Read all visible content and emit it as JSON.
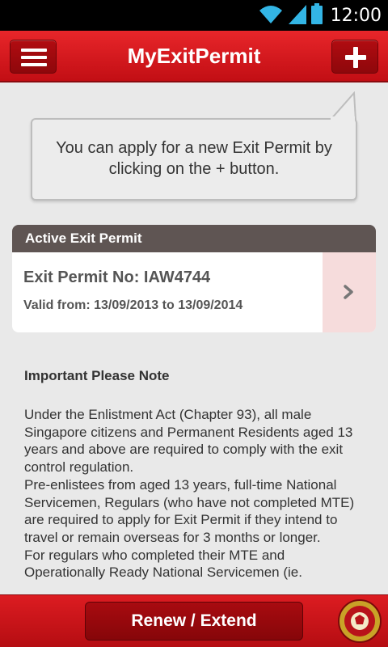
{
  "status_bar": {
    "time": "12:00",
    "icons": [
      "wifi-icon",
      "signal-icon",
      "battery-icon"
    ]
  },
  "header": {
    "title": "MyExitPermit",
    "menu_icon": "hamburger-menu-icon",
    "add_icon": "plus-icon"
  },
  "tip": {
    "text": "You can apply for a new Exit Permit by clicking on the + button."
  },
  "active_permit": {
    "section_title": "Active Exit Permit",
    "permit_no": "Exit Permit No: IAW4744",
    "valid": "Valid from: 13/09/2013 to 13/09/2014",
    "arrow_icon": "chevron-right-icon"
  },
  "note": {
    "title": "Important Please Note",
    "paragraphs": [
      "Under the Enlistment Act (Chapter 93), all male Singapore citizens and Permanent Residents aged 13 years and above are required to comply with the exit control regulation.",
      "Pre-enlistees from aged 13 years, full-time National Servicemen, Regulars (who have not completed MTE) are required to apply for Exit Permit if they intend to travel or remain overseas for 3 months or longer.",
      "For regulars who completed their MTE and Operationally Ready National Servicemen (ie."
    ]
  },
  "footer": {
    "renew_label": "Renew / Extend",
    "crest_icon": "mindef-crest-icon"
  },
  "colors": {
    "brand_red": "#d3161b",
    "card_header": "#5f5553",
    "arrow_panel": "#f6dcdc"
  }
}
